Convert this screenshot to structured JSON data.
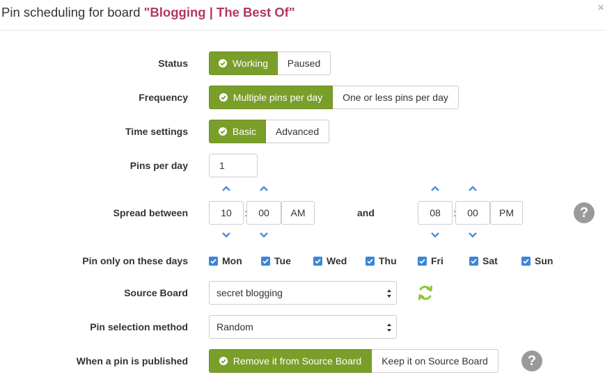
{
  "header": {
    "title_prefix": "Pin scheduling for board ",
    "board_name": "\"Blogging | The Best Of\"",
    "close_glyph": "×"
  },
  "status": {
    "label": "Status",
    "options": [
      "Working",
      "Paused"
    ],
    "selected": "Working"
  },
  "frequency": {
    "label": "Frequency",
    "options": [
      "Multiple pins per day",
      "One or less pins per day"
    ],
    "selected": "Multiple pins per day"
  },
  "time_settings": {
    "label": "Time settings",
    "options": [
      "Basic",
      "Advanced"
    ],
    "selected": "Basic"
  },
  "pins_per_day": {
    "label": "Pins per day",
    "value": "1"
  },
  "spread": {
    "label": "Spread between",
    "start": {
      "hour": "10",
      "minute": "00",
      "ampm": "AM"
    },
    "and_label": "and",
    "end": {
      "hour": "08",
      "minute": "00",
      "ampm": "PM"
    },
    "separator": ":"
  },
  "days": {
    "label": "Pin only on these days",
    "items": [
      {
        "name": "Mon",
        "checked": true
      },
      {
        "name": "Tue",
        "checked": true
      },
      {
        "name": "Wed",
        "checked": true
      },
      {
        "name": "Thu",
        "checked": true
      },
      {
        "name": "Fri",
        "checked": true
      },
      {
        "name": "Sat",
        "checked": true
      },
      {
        "name": "Sun",
        "checked": true
      }
    ]
  },
  "source_board": {
    "label": "Source Board",
    "value": "secret blogging"
  },
  "selection_method": {
    "label": "Pin selection method",
    "value": "Random"
  },
  "published": {
    "label": "When a pin is published",
    "options": [
      "Remove it from Source Board",
      "Keep it on Source Board"
    ],
    "selected": "Remove it from Source Board"
  },
  "help_glyph": "?",
  "colors": {
    "accent": "#7a9e2a",
    "board_name": "#b23a5c",
    "checkbox": "#3b86d6",
    "arrow": "#4a90d9",
    "help": "#9a9a9a",
    "refresh": "#8cc63f"
  },
  "icons": {
    "close": "close-icon",
    "check": "check-circle-icon",
    "arrow_up": "chevron-up-icon",
    "arrow_down": "chevron-down-icon",
    "help": "question-circle-icon",
    "refresh": "refresh-icon",
    "select_caret": "select-caret-icon"
  }
}
